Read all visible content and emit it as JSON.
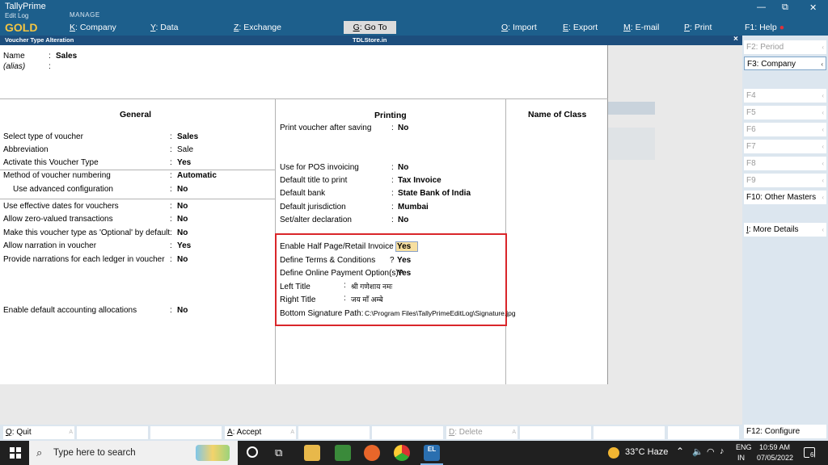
{
  "app": {
    "name": "TallyPrime",
    "edition_sub": "Edit Log",
    "edition": "GOLD",
    "manage_label": "MANAGE"
  },
  "top_menu": [
    {
      "key": "K",
      "label": ": Company"
    },
    {
      "key": "Y",
      "label": ": Data"
    },
    {
      "key": "Z",
      "label": ": Exchange"
    },
    {
      "key": "G",
      "label": ": Go To"
    },
    {
      "key": "O",
      "label": ": Import"
    },
    {
      "key": "E",
      "label": ": Export"
    },
    {
      "key": "M",
      "label": ": E-mail"
    },
    {
      "key": "P",
      "label": ": Print"
    },
    {
      "key": "F1",
      "label": ": Help"
    }
  ],
  "titlebar": {
    "screen": "Voucher Type Alteration",
    "company": "TDLStore.in",
    "close": "×"
  },
  "voucher": {
    "name_label": "Name",
    "name_value": "Sales",
    "alias_label": "(alias)"
  },
  "general": {
    "heading": "General",
    "rows": [
      {
        "label": "Select type of voucher",
        "value": "Sales"
      },
      {
        "label": "Abbreviation",
        "value": "Sale"
      },
      {
        "label": "Activate this Voucher Type",
        "value": "Yes"
      },
      {
        "label": "Method of voucher numbering",
        "value": "Automatic"
      },
      {
        "label": "Use advanced configuration",
        "value": "No"
      },
      {
        "label": "Use effective dates for vouchers",
        "value": "No"
      },
      {
        "label": "Allow zero-valued transactions",
        "value": "No"
      },
      {
        "label": "Make this voucher type as 'Optional' by default",
        "value": "No"
      },
      {
        "label": "Allow narration in voucher",
        "value": "Yes"
      },
      {
        "label": "Provide narrations for each ledger in voucher",
        "value": "No"
      },
      {
        "label": "Enable default accounting allocations",
        "value": "No"
      }
    ]
  },
  "printing": {
    "heading": "Printing",
    "rows": [
      {
        "label": "Print voucher after saving",
        "value": "No"
      },
      {
        "label": "Use for POS invoicing",
        "value": "No"
      },
      {
        "label": "Default title to print",
        "value": "Tax Invoice"
      },
      {
        "label": "Default bank",
        "value": "State Bank of India"
      },
      {
        "label": "Default jurisdiction",
        "value": "Mumbai"
      },
      {
        "label": "Set/alter declaration",
        "value": "No"
      }
    ],
    "custom": [
      {
        "label": "Enable Half Page/Retail Invoice ?",
        "value": "Yes"
      },
      {
        "label": "Define Terms & Conditions",
        "value": "Yes"
      },
      {
        "label": "Define Online Payment Option(s)?",
        "value": "Yes"
      },
      {
        "label": "Left Title",
        "value": "श्री गणेशाय नमः"
      },
      {
        "label": "Right Title",
        "value": "जय माँ अम्बे"
      },
      {
        "label": "Bottom Signature Path:",
        "value": "C:\\Program Files\\TallyPrimeEditLog\\Signature.jpg"
      }
    ],
    "highlight_color": "#d9262a"
  },
  "class": {
    "heading": "Name of Class"
  },
  "right_panel": [
    {
      "key": "F2",
      "label": ": Period",
      "dim": true
    },
    {
      "key": "F3",
      "label": ": Company",
      "dim": false
    },
    {
      "key": "F4",
      "label": "",
      "dim": true
    },
    {
      "key": "F5",
      "label": "",
      "dim": true
    },
    {
      "key": "F6",
      "label": "",
      "dim": true
    },
    {
      "key": "F7",
      "label": "",
      "dim": true
    },
    {
      "key": "F8",
      "label": "",
      "dim": true
    },
    {
      "key": "F9",
      "label": "",
      "dim": true
    },
    {
      "key": "F10",
      "label": ": Other Masters",
      "dim": false
    },
    {
      "key": "I",
      "label": ": More Details",
      "dim": false
    },
    {
      "key": "F12",
      "label": ": Configure",
      "dim": false
    }
  ],
  "bottom_bar": [
    {
      "key": "Q",
      "label": ": Quit"
    },
    {
      "key": "A",
      "label": ": Accept"
    },
    {
      "key": "D",
      "label": ": Delete"
    }
  ],
  "taskbar": {
    "search_placeholder": "Type here to search",
    "weather": "33°C  Haze",
    "lang1": "ENG",
    "lang2": "IN",
    "time": "10:59 AM",
    "date": "07/05/2022",
    "notif_count": "6",
    "el_icon": "EL"
  },
  "colors": {
    "brand": "#1d5f8c",
    "title": "#1d4e7d",
    "gold": "#f4c542"
  }
}
